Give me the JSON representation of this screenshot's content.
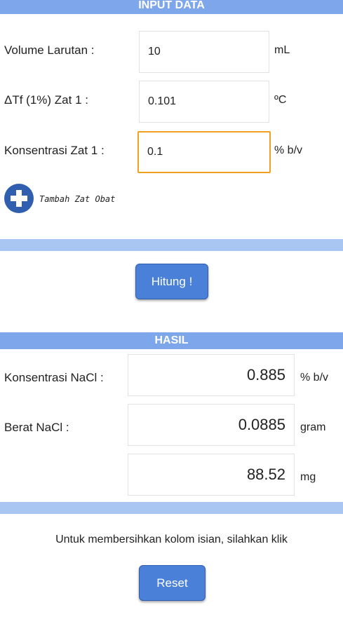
{
  "input": {
    "header": "INPUT DATA",
    "rows": [
      {
        "label": "Volume Larutan :",
        "value": "10",
        "unit": "mL"
      },
      {
        "label": "ΔTf  (1%) Zat 1 :",
        "value": "0.101",
        "unit": "ºC"
      },
      {
        "label": "Konsentrasi Zat 1 :",
        "value": "0.1",
        "unit": "% b/v"
      }
    ],
    "add_label": "Tambah Zat Obat"
  },
  "calculate_label": "Hitung !",
  "result": {
    "header": "HASIL",
    "rows": [
      {
        "label": "Konsentrasi NaCl :",
        "value": "0.885",
        "unit": "% b/v"
      },
      {
        "label": "Berat NaCl :",
        "value": "0.0885",
        "unit": "gram"
      },
      {
        "label": "",
        "value": "88.52",
        "unit": "mg"
      }
    ]
  },
  "reset": {
    "hint": "Untuk membersihkan kolom isian, silahkan klik",
    "label": "Reset"
  },
  "colors": {
    "header_band": "#7ea6ea",
    "divider_band": "#a9c6f2",
    "button": "#4a80d8",
    "focus_border": "#f0a020",
    "add_icon": "#2f5fae"
  }
}
